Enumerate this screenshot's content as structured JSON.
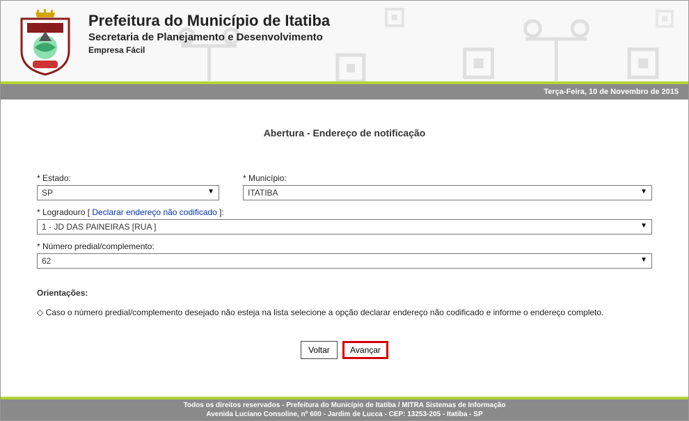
{
  "header": {
    "title": "Prefeitura do Município de Itatiba",
    "subtitle": "Secretaria de Planejamento e Desenvolvimento",
    "app_name": "Empresa Fácil"
  },
  "date_bar": "Terça-Feira, 10 de Novembro de 2015",
  "page_heading": "Abertura - Endereço de notificação",
  "form": {
    "estado": {
      "label": "* Estado:",
      "value": "SP"
    },
    "municipio": {
      "label": "* Município:",
      "value": "ITATIBA"
    },
    "logradouro": {
      "label_prefix": "* Logradouro [ ",
      "label_link": "Declarar endereço não codificado",
      "label_suffix": " ]:",
      "value": "1 - JD DAS PAINEIRAS [RUA ]"
    },
    "numero": {
      "label": "* Número predial/complemento:",
      "value": "62"
    }
  },
  "orientacoes": {
    "title": "Orientações:",
    "items": [
      "◇ Caso o número predial/complemento desejado não esteja na lista selecione a opção declarar endereço não codificado e informe o endereço completo."
    ]
  },
  "buttons": {
    "voltar": "Voltar",
    "avancar": "Avançar"
  },
  "footer": {
    "line1": "Todos os direitos reservados - Prefeitura do Município de Itatiba / MITRA Sistemas de Informação",
    "line2": "Avenida Luciano Consoline, nº 600 - Jardim de Lucca - CEP: 13253-205 - Itatiba - SP"
  }
}
